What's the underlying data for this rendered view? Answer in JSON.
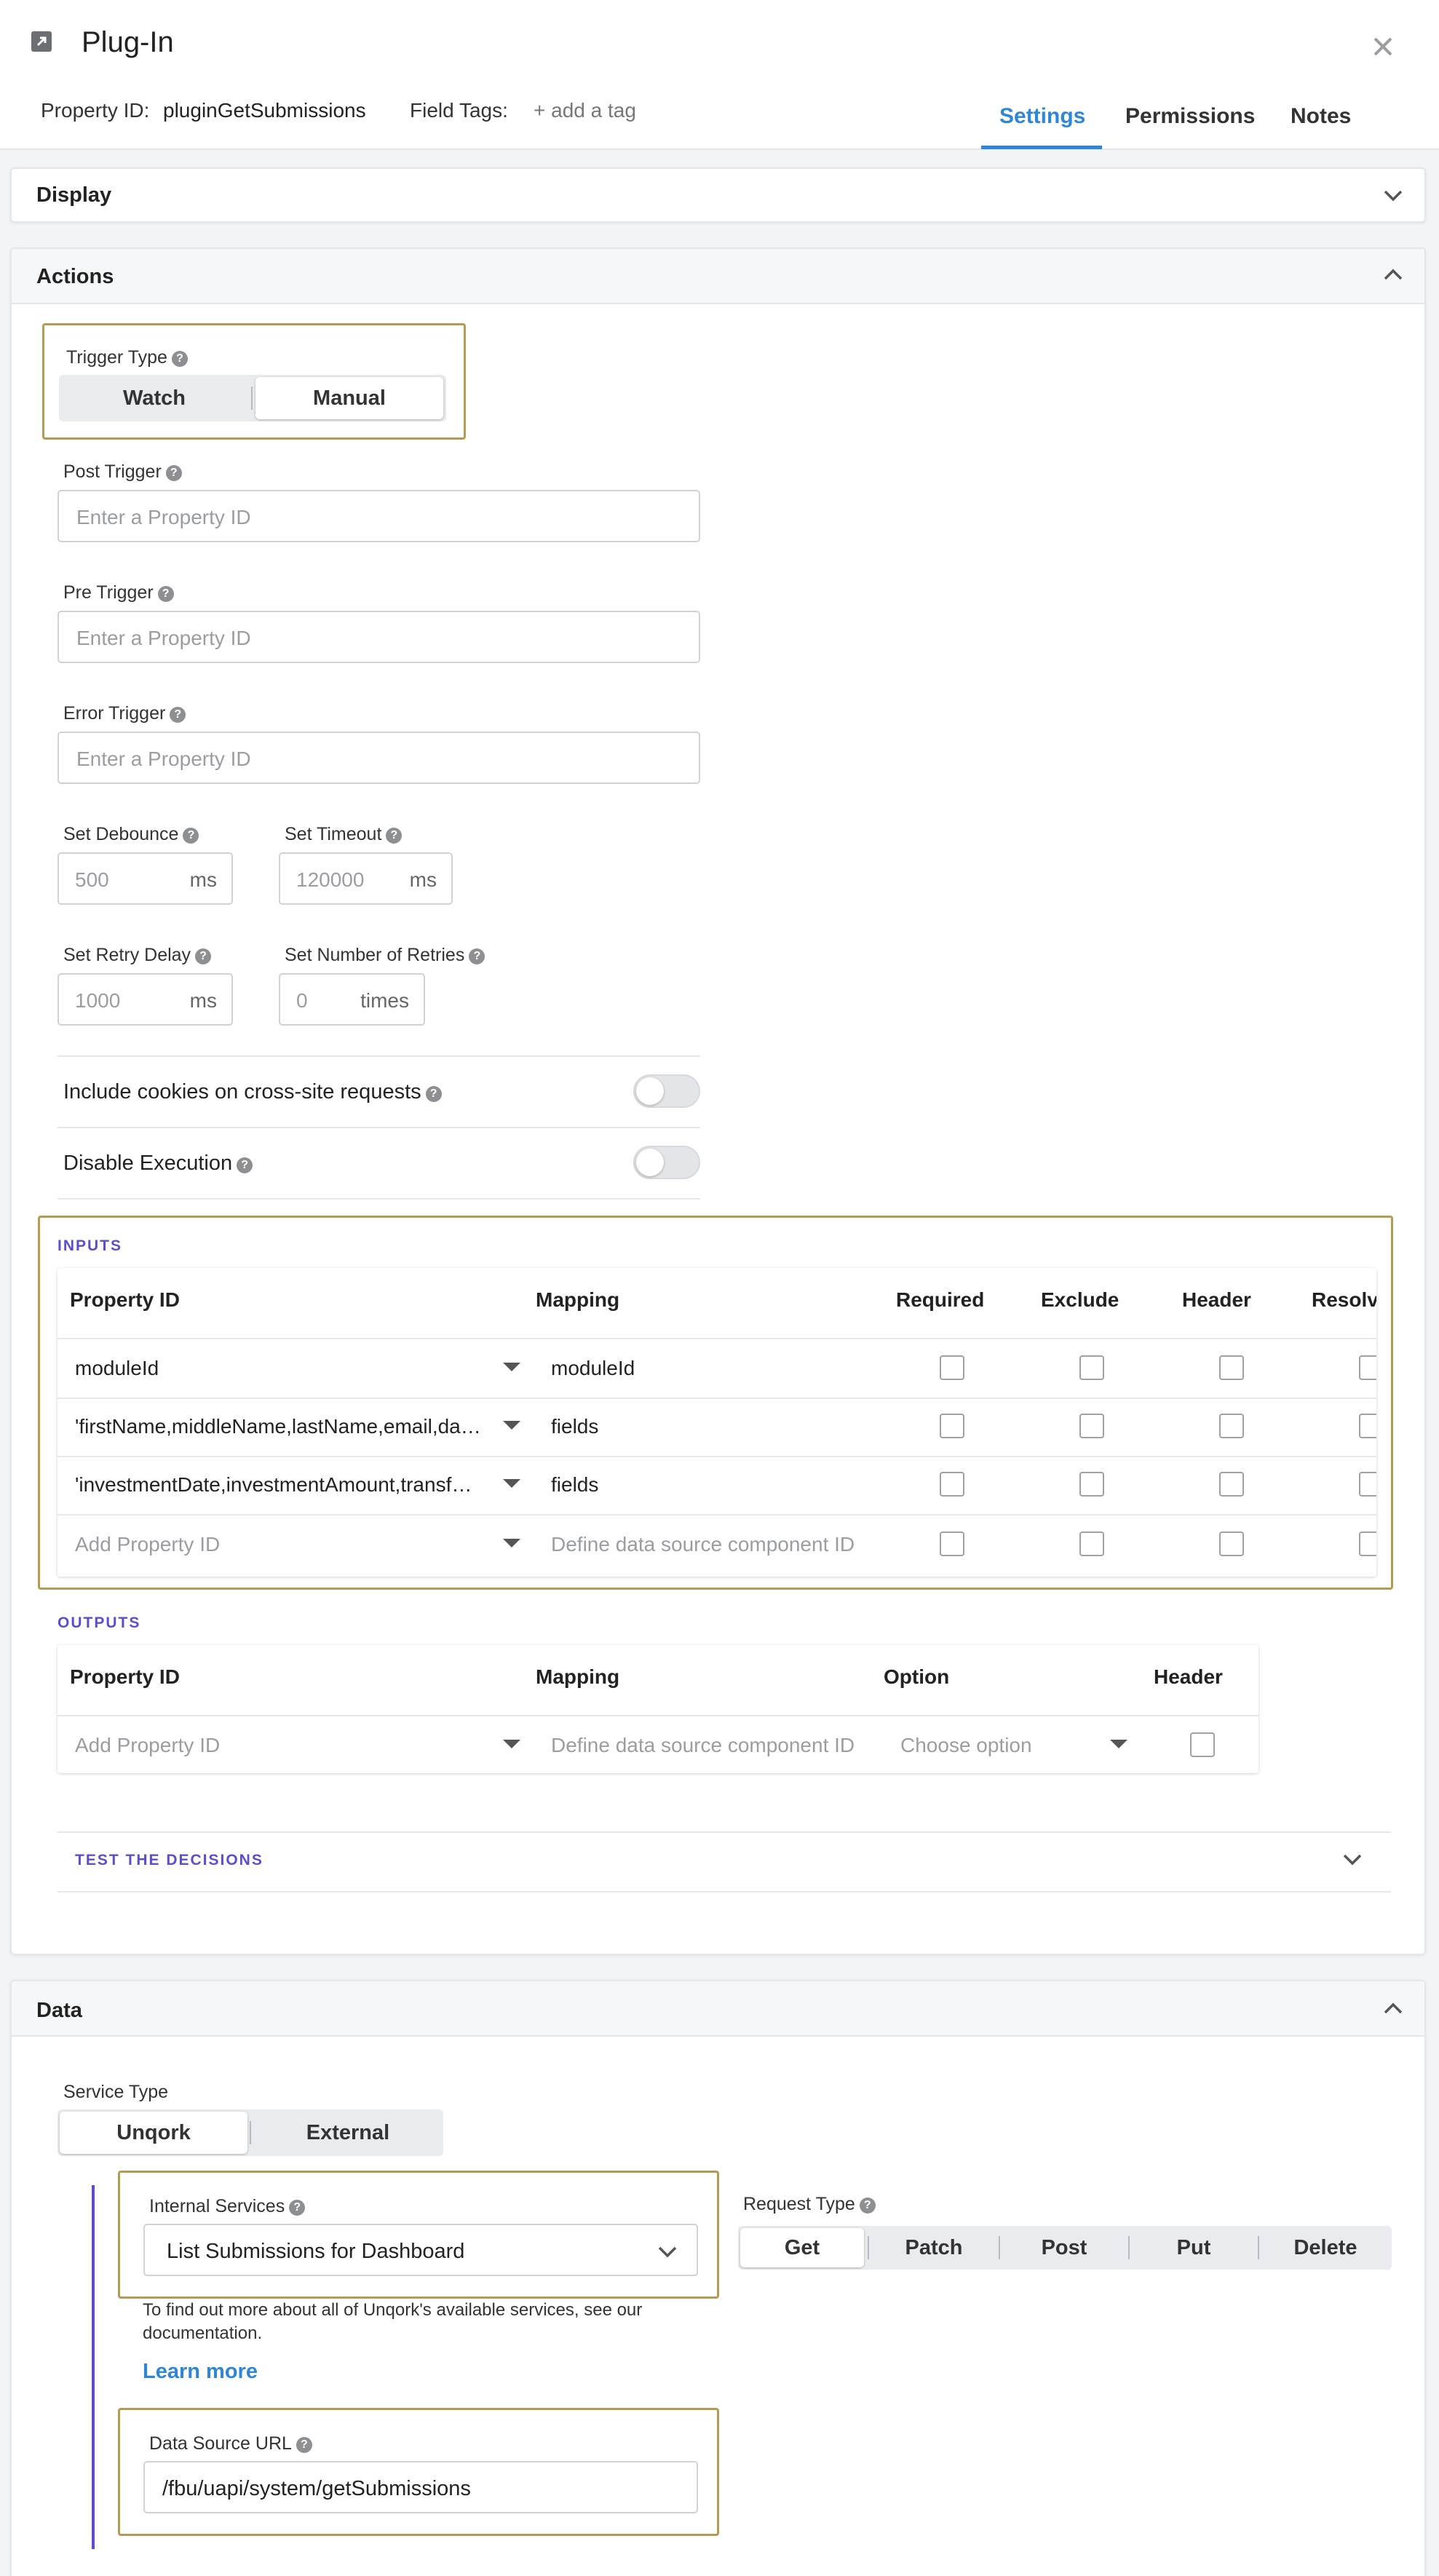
{
  "header": {
    "title": "Plug-In",
    "property_id_label": "Property ID:",
    "property_id_value": "pluginGetSubmissions",
    "field_tags_label": "Field Tags:",
    "add_tag": "+ add a tag",
    "tabs": [
      {
        "label": "Settings",
        "active": true
      },
      {
        "label": "Permissions",
        "active": false
      },
      {
        "label": "Notes",
        "active": false
      }
    ],
    "accent_color": "#2e86d6"
  },
  "display_panel": {
    "title": "Display",
    "expanded": false
  },
  "actions_panel": {
    "title": "Actions",
    "expanded": true,
    "trigger_type": {
      "label": "Trigger Type",
      "options": [
        "Watch",
        "Manual"
      ],
      "selected": "Manual"
    },
    "post_trigger": {
      "label": "Post Trigger",
      "placeholder": "Enter a Property ID"
    },
    "pre_trigger": {
      "label": "Pre Trigger",
      "placeholder": "Enter a Property ID"
    },
    "error_trigger": {
      "label": "Error Trigger",
      "placeholder": "Enter a Property ID"
    },
    "set_debounce": {
      "label": "Set Debounce",
      "placeholder": "500",
      "unit": "ms"
    },
    "set_timeout": {
      "label": "Set Timeout",
      "placeholder": "120000",
      "unit": "ms"
    },
    "set_retry_delay": {
      "label": "Set Retry Delay",
      "placeholder": "1000",
      "unit": "ms"
    },
    "set_retries": {
      "label": "Set Number of Retries",
      "placeholder": "0",
      "unit": "times"
    },
    "include_cookies": {
      "label": "Include cookies on cross-site requests",
      "on": false
    },
    "disable_execution": {
      "label": "Disable Execution",
      "on": false
    },
    "inputs": {
      "caption": "INPUTS",
      "columns": [
        "Property ID",
        "Mapping",
        "Required",
        "Exclude",
        "Header",
        "Resolve"
      ],
      "rows": [
        {
          "property_id": "moduleId",
          "mapping": "moduleId"
        },
        {
          "property_id": "'firstName,middleName,lastName,email,da…",
          "mapping": "fields"
        },
        {
          "property_id": "'investmentDate,investmentAmount,transf…",
          "mapping": "fields"
        }
      ],
      "add_placeholder": "Add Property ID",
      "mapping_placeholder": "Define data source component ID"
    },
    "outputs": {
      "caption": "OUTPUTS",
      "columns": [
        "Property ID",
        "Mapping",
        "Option",
        "Header"
      ],
      "add_placeholder": "Add Property ID",
      "mapping_placeholder": "Define data source component ID",
      "option_placeholder": "Choose option"
    },
    "test_decisions": "TEST THE DECISIONS"
  },
  "data_panel": {
    "title": "Data",
    "expanded": true,
    "service_type": {
      "label": "Service Type",
      "options": [
        "Unqork",
        "External"
      ],
      "selected": "Unqork"
    },
    "internal_services": {
      "label": "Internal Services",
      "value": "List Submissions for Dashboard"
    },
    "help_text": "To find out more about all of Unqork's available services, see our documentation.",
    "learn_more": "Learn more",
    "request_type": {
      "label": "Request Type",
      "options": [
        "Get",
        "Patch",
        "Post",
        "Put",
        "Delete"
      ],
      "selected": "Get"
    },
    "data_source_url": {
      "label": "Data Source URL",
      "value": "/fbu/uapi/system/getSubmissions"
    }
  },
  "colors": {
    "highlight": "#b59a52",
    "section_caption": "#5a4fcf",
    "rail": "#5a4fcf"
  }
}
